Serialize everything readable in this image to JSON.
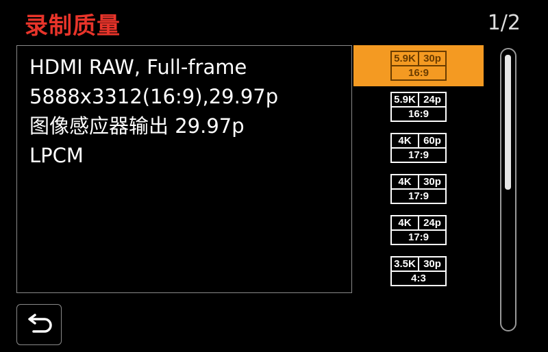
{
  "header": {
    "title": "录制质量",
    "title_color": "#e8342a",
    "page_indicator": "1/2"
  },
  "info_panel": {
    "lines": [
      "HDMI RAW, Full-frame",
      "5888x3312(16:9),29.97p",
      "图像感应器输出 29.97p",
      "LPCM"
    ]
  },
  "menu": {
    "selected_index": 0,
    "selected_color": "#f49a22",
    "items": [
      {
        "resolution": "5.9K",
        "framerate": "30p",
        "aspect": "16:9"
      },
      {
        "resolution": "5.9K",
        "framerate": "24p",
        "aspect": "16:9"
      },
      {
        "resolution": "4K",
        "framerate": "60p",
        "aspect": "17:9"
      },
      {
        "resolution": "4K",
        "framerate": "30p",
        "aspect": "17:9"
      },
      {
        "resolution": "4K",
        "framerate": "24p",
        "aspect": "17:9"
      },
      {
        "resolution": "3.5K",
        "framerate": "30p",
        "aspect": "4:3"
      }
    ]
  },
  "scrollbar": {
    "position_fraction": 0.0,
    "visible_fraction": 0.5
  },
  "footer": {
    "back_icon": "return-arrow-icon"
  }
}
